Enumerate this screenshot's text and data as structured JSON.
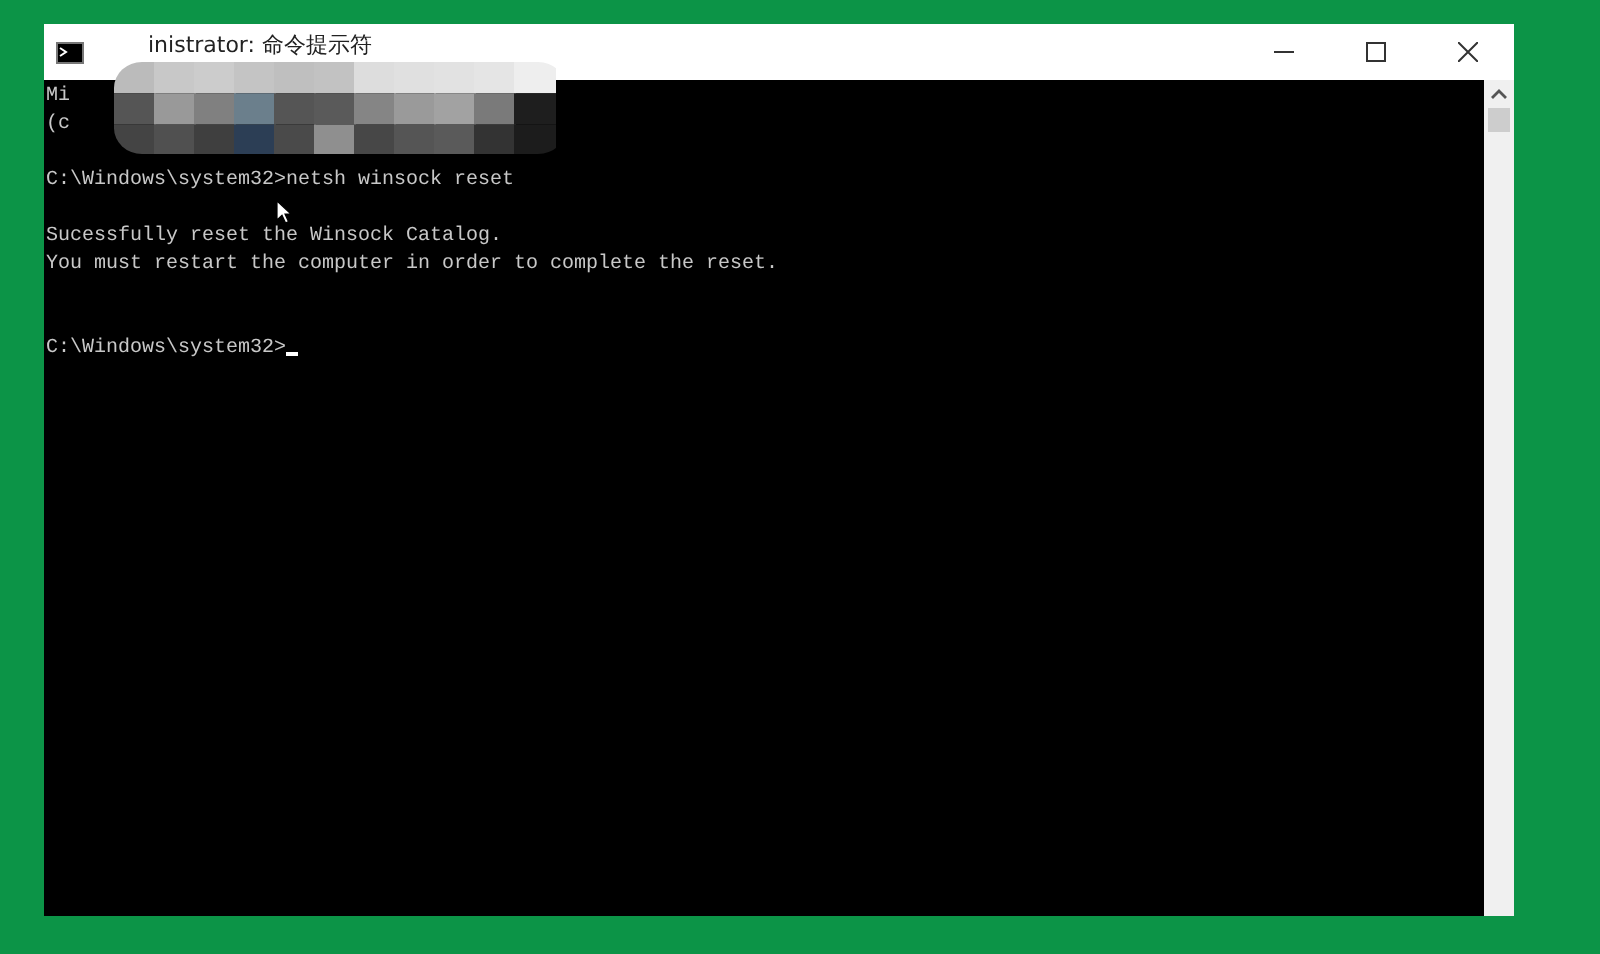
{
  "window": {
    "title": "inistrator: 命令提示符"
  },
  "console": {
    "lines": [
      {
        "kind": "text",
        "text": "Mi"
      },
      {
        "kind": "text",
        "text": "(c"
      },
      {
        "kind": "blank"
      },
      {
        "kind": "text",
        "text": "C:\\Windows\\system32>netsh winsock reset"
      },
      {
        "kind": "blank"
      },
      {
        "kind": "text",
        "text": "Sucessfully reset the Winsock Catalog."
      },
      {
        "kind": "text",
        "text": "You must restart the computer in order to complete the reset."
      },
      {
        "kind": "blank"
      },
      {
        "kind": "blank"
      },
      {
        "kind": "prompt",
        "text": "C:\\Windows\\system32>",
        "cursor": true
      }
    ]
  }
}
